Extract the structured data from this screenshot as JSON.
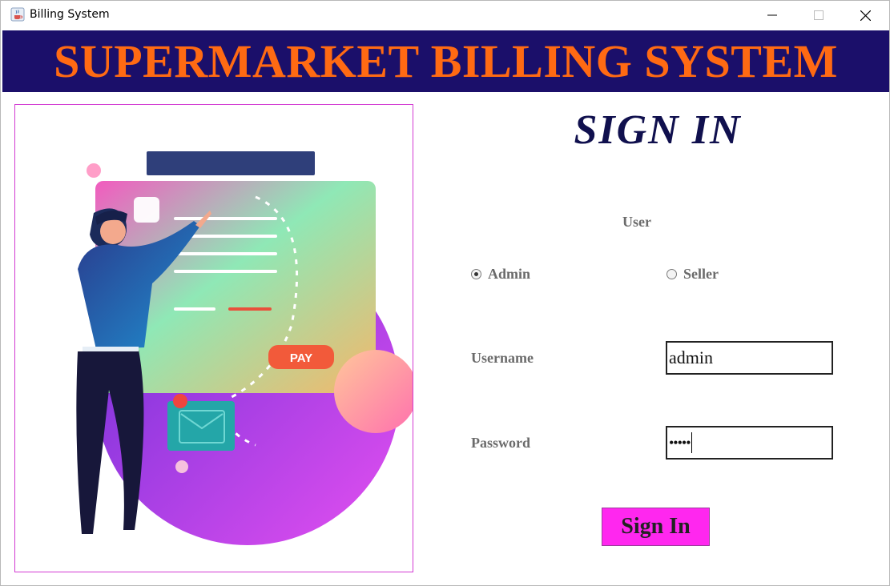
{
  "window": {
    "title": "Billing System",
    "controls": {
      "minimize": "—",
      "maximize": "☐",
      "close": "✕"
    }
  },
  "banner": {
    "title": "SUPERMARKET BILLING SYSTEM",
    "background": "#1b0f6a",
    "color": "#ff6a13"
  },
  "illustration": {
    "pay_label": "PAY"
  },
  "form": {
    "heading": "SIGN IN",
    "user_label": "User",
    "roles": [
      {
        "label": "Admin",
        "selected": true
      },
      {
        "label": "Seller",
        "selected": false
      }
    ],
    "username_label": "Username",
    "username_value": "admin",
    "password_label": "Password",
    "password_masked": "•••••",
    "submit_label": "Sign In",
    "submit_color": "#ff27ef"
  }
}
